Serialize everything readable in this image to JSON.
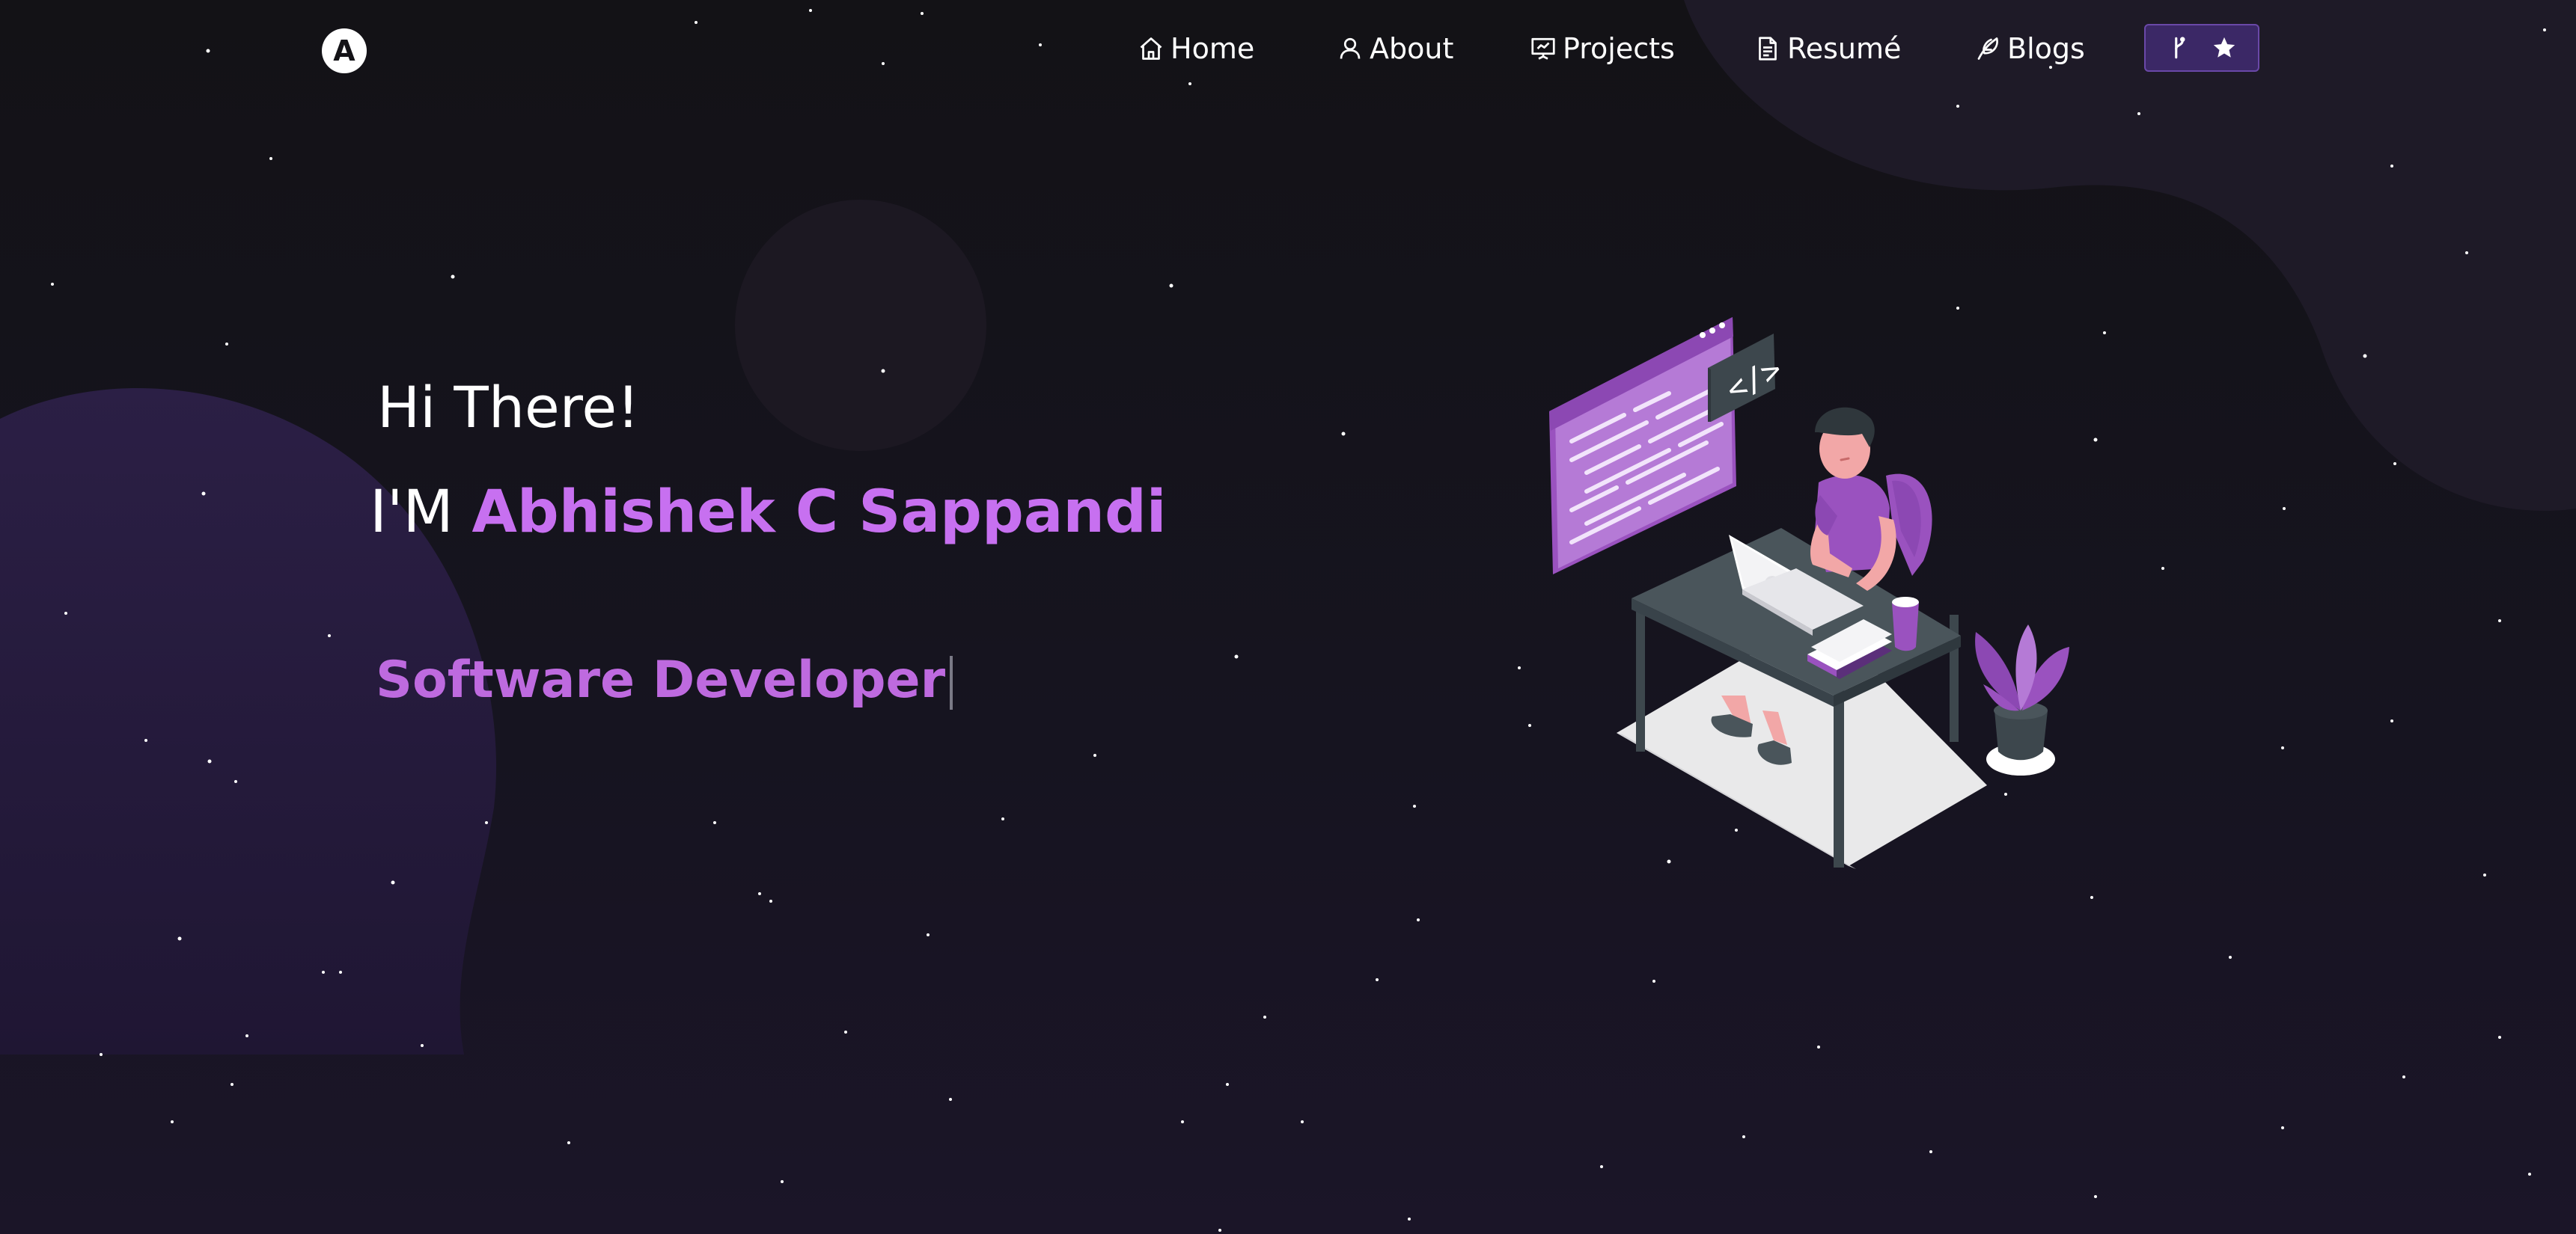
{
  "nav": {
    "logo_letter": "A",
    "items": [
      {
        "label": "Home",
        "icon": "home-icon"
      },
      {
        "label": "About",
        "icon": "user-icon"
      },
      {
        "label": "Projects",
        "icon": "presentation-icon"
      },
      {
        "label": "Resumé",
        "icon": "document-icon"
      },
      {
        "label": "Blogs",
        "icon": "feather-icon"
      }
    ],
    "fork_button": {
      "icons": [
        "git-fork-icon",
        "star-icon"
      ]
    }
  },
  "hero": {
    "greeting": "Hi There!",
    "intro_prefix": "I'M ",
    "name": "Abhishek C Sappandi",
    "role": "Software Developer"
  },
  "colors": {
    "background": "#141317",
    "accent": "#c770f0",
    "button_bg": "#3b2866"
  }
}
